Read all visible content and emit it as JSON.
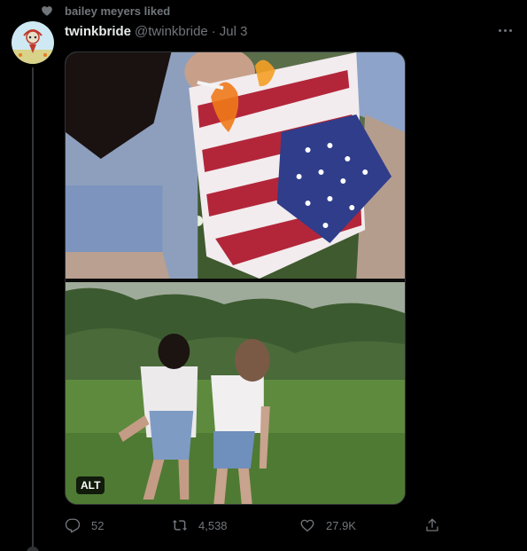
{
  "social_context": {
    "text": "bailey meyers liked"
  },
  "tweet": {
    "display_name": "twinkbride",
    "handle": "@twinkbride",
    "separator": "·",
    "date": "Jul 3"
  },
  "media": {
    "alt_label": "ALT",
    "image_count": 2
  },
  "actions": {
    "reply_count": "52",
    "retweet_count": "4,538",
    "like_count": "27.9K"
  },
  "colors": {
    "background": "#000000",
    "primary_text": "#e7e9ea",
    "secondary_text": "#71767b",
    "border": "#2f3336"
  },
  "icons": [
    "heart-icon",
    "more-icon",
    "reply-icon",
    "retweet-icon",
    "like-icon",
    "share-icon"
  ]
}
